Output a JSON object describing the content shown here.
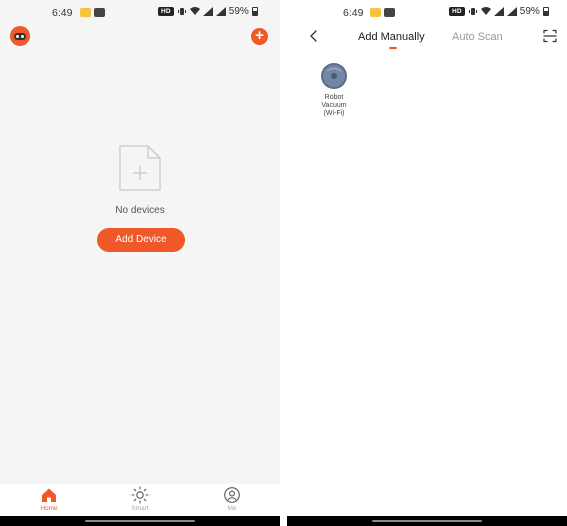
{
  "left_screen": {
    "status_bar": {
      "time": "6:49",
      "hd_label": "HD",
      "battery": "59%"
    },
    "empty_state": {
      "message": "No devices",
      "button_label": "Add Device"
    },
    "bottom_nav": {
      "items": [
        {
          "label": "Home",
          "icon": "home-icon",
          "active": true
        },
        {
          "label": "Smart",
          "icon": "sun-icon",
          "active": false
        },
        {
          "label": "Me",
          "icon": "user-icon",
          "active": false
        }
      ]
    }
  },
  "right_screen": {
    "status_bar": {
      "time": "6:49",
      "hd_label": "HD",
      "battery": "59%"
    },
    "tabs": [
      {
        "label": "Add Manually",
        "active": true
      },
      {
        "label": "Auto Scan",
        "active": false
      }
    ],
    "devices": [
      {
        "line1": "Robot",
        "line2": "Vacuum",
        "line3": "(Wi-Fi)",
        "icon": "robot-vacuum-icon"
      }
    ]
  },
  "colors": {
    "accent": "#f0582a",
    "background_left": "#f5f5f5",
    "background_right": "#ffffff",
    "text_primary": "#222222",
    "text_muted": "#999999"
  }
}
